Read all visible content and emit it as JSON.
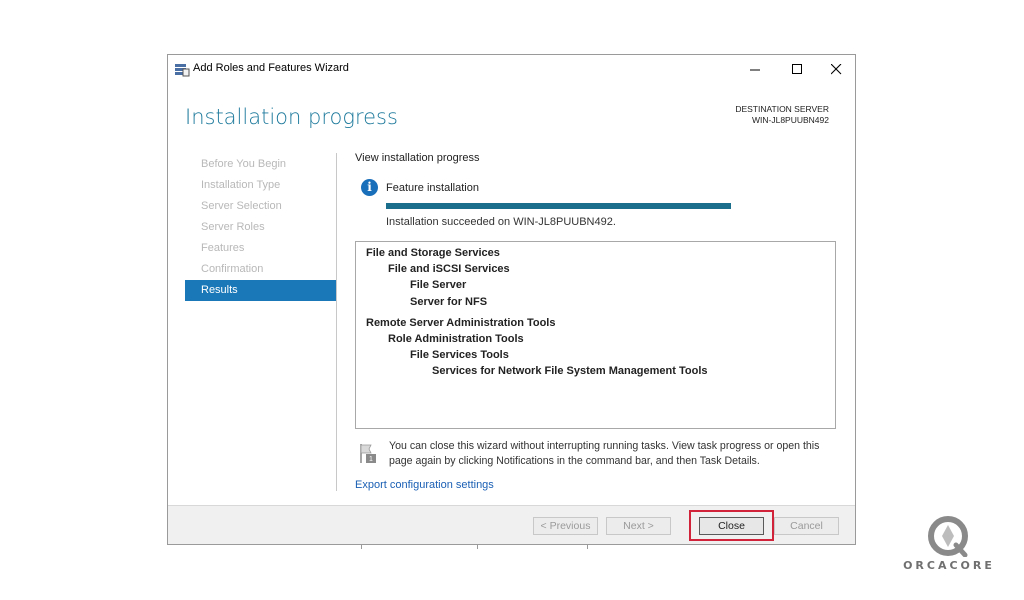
{
  "window": {
    "title": "Add Roles and Features Wizard"
  },
  "page_title": "Installation progress",
  "destination": {
    "label": "DESTINATION SERVER",
    "server": "WIN-JL8PUUBN492"
  },
  "nav": {
    "items": [
      {
        "label": "Before You Begin"
      },
      {
        "label": "Installation Type"
      },
      {
        "label": "Server Selection"
      },
      {
        "label": "Server Roles"
      },
      {
        "label": "Features"
      },
      {
        "label": "Confirmation"
      },
      {
        "label": "Results"
      }
    ]
  },
  "content": {
    "section_label": "View installation progress",
    "feature_label": "Feature installation",
    "progress_fraction": 1.0,
    "status": "Installation succeeded on WIN-JL8PUUBN492.",
    "results": [
      {
        "text": "File and Storage Services"
      },
      {
        "text": "File and iSCSI Services"
      },
      {
        "text": "File Server"
      },
      {
        "text": "Server for NFS"
      },
      {
        "text": "Remote Server Administration Tools"
      },
      {
        "text": "Role Administration Tools"
      },
      {
        "text": "File Services Tools"
      },
      {
        "text": "Services for Network File System Management Tools"
      }
    ],
    "note": "You can close this wizard without interrupting running tasks. View task progress or open this page again by clicking Notifications in the command bar, and then Task Details.",
    "export_link": "Export configuration settings"
  },
  "footer": {
    "previous": "< Previous",
    "next": "Next >",
    "close": "Close",
    "cancel": "Cancel"
  },
  "brand": {
    "text": "ORCACORE"
  },
  "colors": {
    "accent": "#1a78b8",
    "progress": "#1c6f8c",
    "highlight": "#d1233a",
    "title": "#1e7a9c"
  }
}
